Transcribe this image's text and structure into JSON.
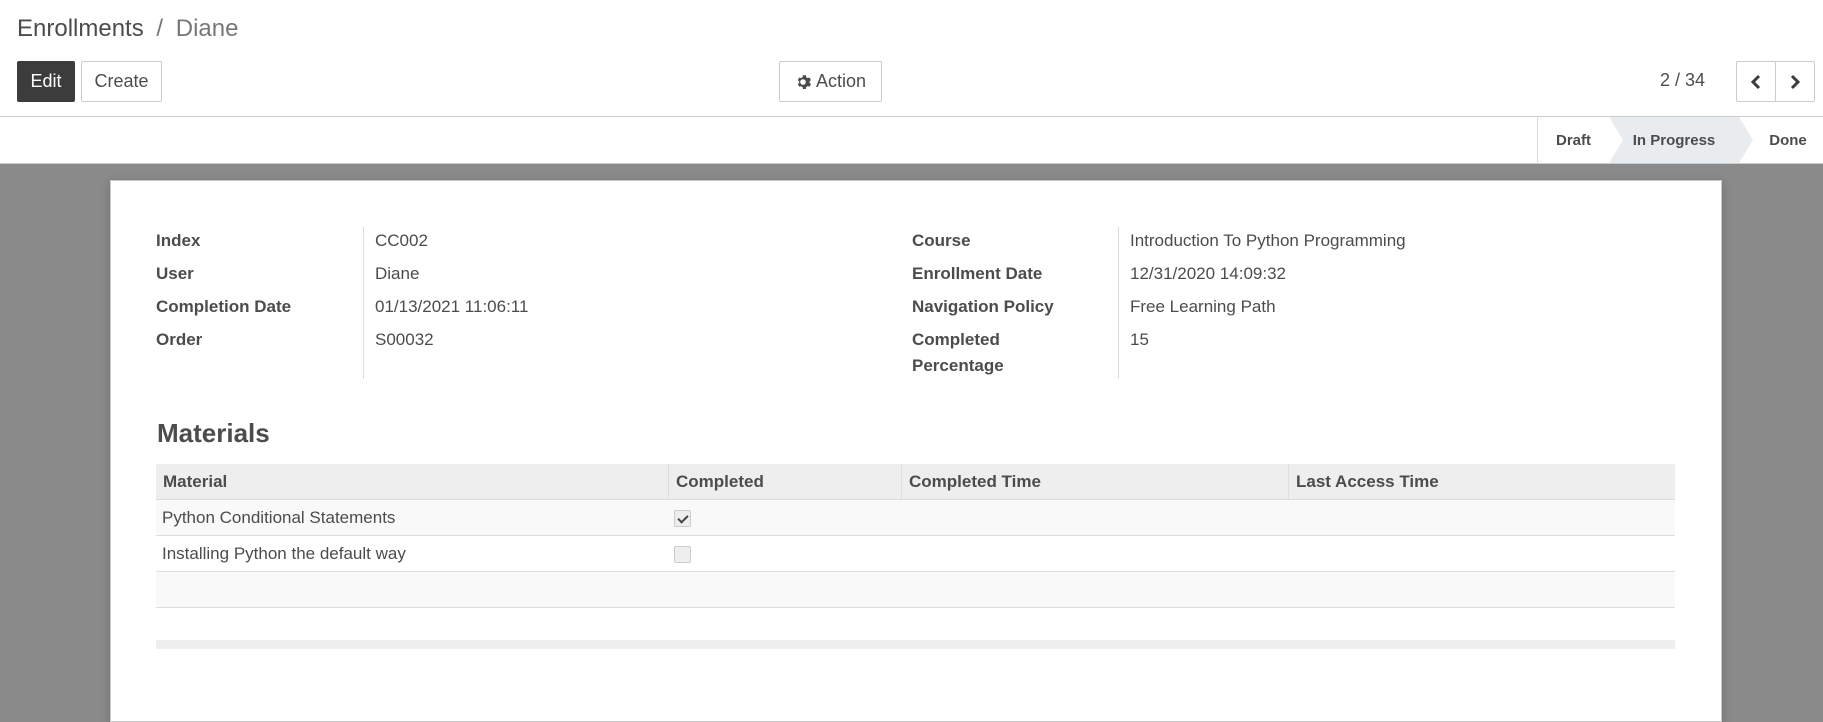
{
  "breadcrumb": {
    "parent": "Enrollments",
    "separator": "/",
    "current": "Diane"
  },
  "buttons": {
    "edit": "Edit",
    "create": "Create",
    "action": "Action"
  },
  "pager": {
    "value": "2 / 34"
  },
  "status": {
    "steps": [
      "Draft",
      "In Progress",
      "Done"
    ],
    "active": "In Progress"
  },
  "fields_left": [
    {
      "label": "Index",
      "value": "CC002"
    },
    {
      "label": "User",
      "value": "Diane"
    },
    {
      "label": "Completion Date",
      "value": "01/13/2021 11:06:11"
    },
    {
      "label": "Order",
      "value": "S00032"
    }
  ],
  "fields_right": [
    {
      "label": "Course",
      "value": "Introduction To Python Programming"
    },
    {
      "label": "Enrollment Date",
      "value": "12/31/2020 14:09:32"
    },
    {
      "label": "Navigation Policy",
      "value": "Free Learning Path"
    },
    {
      "label": "Completed Percentage",
      "value": "15"
    }
  ],
  "materials": {
    "title": "Materials",
    "columns": [
      "Material",
      "Completed",
      "Completed Time",
      "Last Access Time"
    ],
    "rows": [
      {
        "material": "Python Conditional Statements",
        "completed": true,
        "completed_time": "",
        "last_access_time": ""
      },
      {
        "material": "Installing Python the default way",
        "completed": false,
        "completed_time": "",
        "last_access_time": ""
      }
    ]
  },
  "colors": {
    "primary_button": "#3c3c3c",
    "background": "#8a8a8a",
    "status_active": "#e9ecef"
  }
}
